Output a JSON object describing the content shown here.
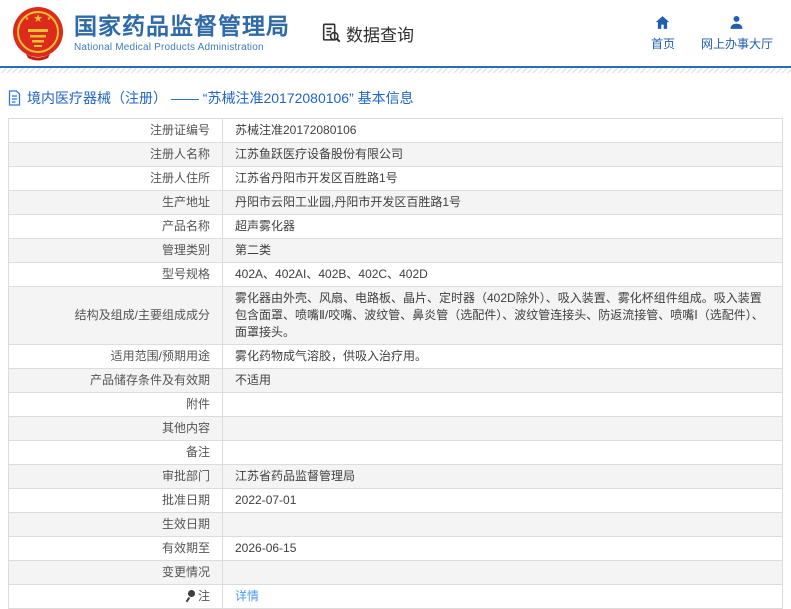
{
  "header": {
    "org_name_cn": "国家药品监督管理局",
    "org_name_en": "National Medical Products Administration",
    "section_label": "数据查询",
    "nav": [
      {
        "label": "首页",
        "icon": "home-icon"
      },
      {
        "label": "网上办事大厅",
        "icon": "user-icon"
      }
    ]
  },
  "page_title": "境内医疗器械（注册） ——  “苏械注准20172080106” 基本信息",
  "colors": {
    "brand_blue": "#2e6aa8",
    "nav_blue": "#1f5fb0",
    "title_blue": "#2166c5",
    "link_blue": "#4a9bf0",
    "header_rule_blue": "#2a6cb5",
    "row_stripe": "#f4f4f4",
    "table_border": "#dcdcdc",
    "emblem_red": "#dc2a1c",
    "emblem_gold": "#f2bf35"
  },
  "table": {
    "rows": [
      {
        "label": "注册证编号",
        "value": "苏械注准20172080106"
      },
      {
        "label": "注册人名称",
        "value": "江苏鱼跃医疗设备股份有限公司"
      },
      {
        "label": "注册人住所",
        "value": "江苏省丹阳市开发区百胜路1号"
      },
      {
        "label": "生产地址",
        "value": "丹阳市云阳工业园,丹阳市开发区百胜路1号"
      },
      {
        "label": "产品名称",
        "value": "超声雾化器"
      },
      {
        "label": "管理类别",
        "value": "第二类"
      },
      {
        "label": "型号规格",
        "value": "402A、402AI、402B、402C、402D"
      },
      {
        "label": "结构及组成/主要组成成分",
        "value": "雾化器由外壳、风扇、电路板、晶片、定时器（402D除外）、吸入装置、雾化杯组件组成。吸入装置包含面罩、喷嘴Ⅱ/咬嘴、波纹管、鼻炎管（选配件）、波纹管连接头、防返流接管、喷嘴Ⅰ（选配件）、面罩接头。"
      },
      {
        "label": "适用范围/预期用途",
        "value": "雾化药物成气溶胶，供吸入治疗用。"
      },
      {
        "label": "产品储存条件及有效期",
        "value": "不适用"
      },
      {
        "label": "附件",
        "value": ""
      },
      {
        "label": "其他内容",
        "value": ""
      },
      {
        "label": "备注",
        "value": ""
      },
      {
        "label": "审批部门",
        "value": "江苏省药品监督管理局"
      },
      {
        "label": "批准日期",
        "value": "2022-07-01"
      },
      {
        "label": "生效日期",
        "value": ""
      },
      {
        "label": "有效期至",
        "value": "2026-06-15"
      },
      {
        "label": "变更情况",
        "value": ""
      },
      {
        "label": "注",
        "value": "详情",
        "value_is_link": true,
        "label_icon": "note-pin"
      }
    ]
  }
}
